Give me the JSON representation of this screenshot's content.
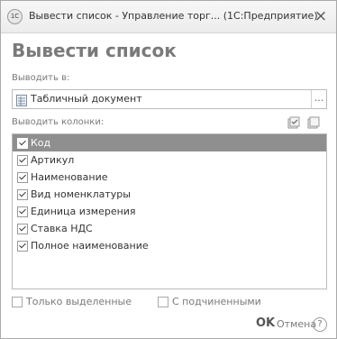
{
  "window": {
    "title": "Вывести список - Управление торг...  (1С:Предприятие)",
    "app_icon_text": "1С",
    "close_glyph": "×"
  },
  "form": {
    "heading": "Вывести список",
    "output_label": "Выводить в:",
    "output_value": "Табличный документ",
    "output_more": "...",
    "columns_label": "Выводить колонки:",
    "columns": [
      {
        "label": "Код",
        "checked": true,
        "selected": true
      },
      {
        "label": "Артикул",
        "checked": true,
        "selected": false
      },
      {
        "label": "Наименование",
        "checked": true,
        "selected": false
      },
      {
        "label": "Вид номенклатуры",
        "checked": true,
        "selected": false
      },
      {
        "label": "Единица измерения",
        "checked": true,
        "selected": false
      },
      {
        "label": "Ставка НДС",
        "checked": true,
        "selected": false
      },
      {
        "label": "Полное наименование",
        "checked": true,
        "selected": false
      }
    ],
    "only_selected_label": "Только выделенные",
    "with_subordinates_label": "С подчиненными",
    "ok_label": "OK",
    "cancel_label": "Отмена",
    "help_label": "?"
  }
}
